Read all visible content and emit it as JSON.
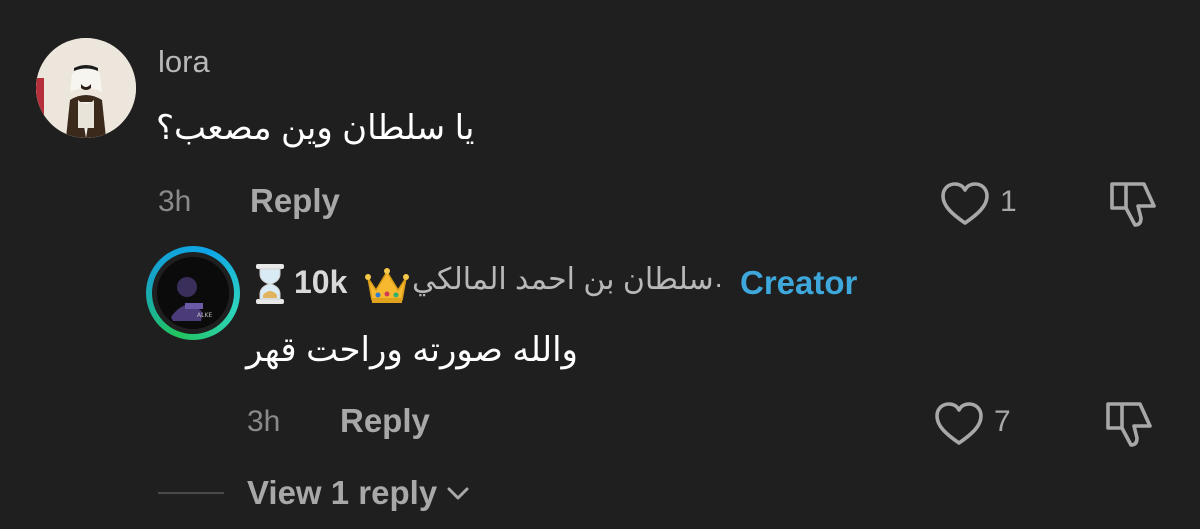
{
  "comments": [
    {
      "username": "lora",
      "text": "يا سلطان وين مصعب؟",
      "time": "3h",
      "reply_label": "Reply",
      "like_count": "1",
      "avatar_icon": "profile-photo"
    },
    {
      "badge_hourglass_icon": "hourglass-icon",
      "badge_followers": "10k",
      "badge_crown_icon": "crown-icon",
      "username": "سلطان بن احمد المالكي",
      "separator": "·",
      "creator_label": "Creator",
      "text": "والله صورته وراحت قهر",
      "time": "3h",
      "reply_label": "Reply",
      "like_count": "7",
      "avatar_ring_color": "#22c55e"
    }
  ],
  "view_replies_label": "View 1 reply",
  "colors": {
    "background": "#1f1f1f",
    "creator": "#3ea8dc",
    "muted": "#a8a8a8"
  }
}
